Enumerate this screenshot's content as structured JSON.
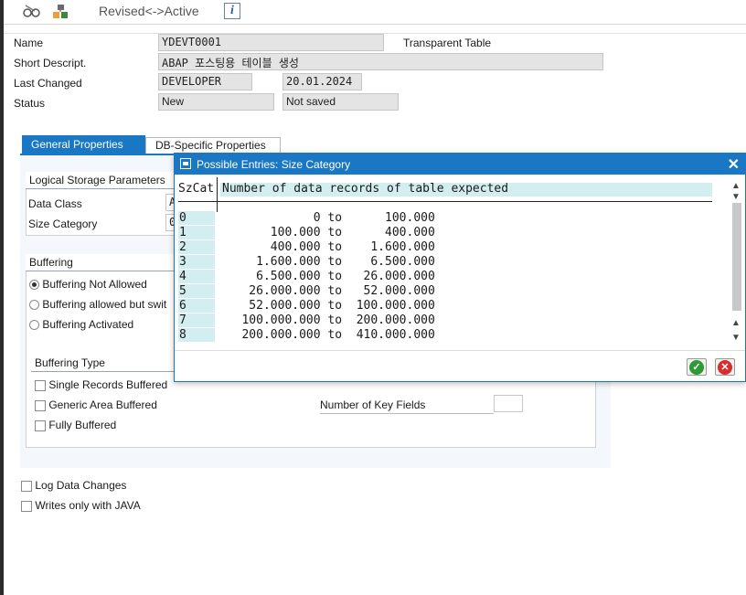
{
  "toolbar": {
    "glasses_icon": "glasses-icon",
    "hierarchy_icon": "hierarchy-icon",
    "toggle_label": "Revised<->Active",
    "info_icon_glyph": "i"
  },
  "header": {
    "name_label": "Name",
    "name_value": "YDEVT0001",
    "object_type": "Transparent Table",
    "short_desc_label": "Short Descript.",
    "short_desc_value": "ABAP 포스팅용 테이블 생성",
    "last_changed_label": "Last Changed",
    "last_changed_user": "DEVELOPER",
    "last_changed_date": "20.01.2024",
    "status_label": "Status",
    "status_value": "New",
    "save_status": "Not saved"
  },
  "tabs": [
    {
      "label": "General Properties",
      "active": true
    },
    {
      "label": "DB-Specific Properties",
      "active": false
    }
  ],
  "general": {
    "logical_storage_title": "Logical Storage Parameters",
    "data_class_label": "Data Class",
    "data_class_value": "A",
    "size_category_label": "Size Category",
    "size_category_value": "0",
    "buffering_title": "Buffering",
    "buffering_options": [
      {
        "label": "Buffering Not Allowed",
        "selected": true
      },
      {
        "label": "Buffering allowed but swit",
        "selected": false
      },
      {
        "label": "Buffering Activated",
        "selected": false
      }
    ],
    "buffering_type_title": "Buffering Type",
    "buffering_types": [
      {
        "label": "Single Records Buffered",
        "checked": false
      },
      {
        "label": "Generic Area Buffered",
        "checked": false
      },
      {
        "label": "Fully Buffered",
        "checked": false
      }
    ],
    "key_fields_label": "Number of Key Fields",
    "key_fields_value": "",
    "log_data_changes": "Log Data Changes",
    "writes_only_java": "Writes only with JAVA"
  },
  "dialog": {
    "title": "Possible Entries: Size Category",
    "col_cat": "SzCat",
    "col_desc": "Number of data records of table expected",
    "rows": [
      {
        "cat": "0",
        "from": "0",
        "to": "100.000"
      },
      {
        "cat": "1",
        "from": "100.000",
        "to": "400.000"
      },
      {
        "cat": "2",
        "from": "400.000",
        "to": "1.600.000"
      },
      {
        "cat": "3",
        "from": "1.600.000",
        "to": "6.500.000"
      },
      {
        "cat": "4",
        "from": "6.500.000",
        "to": "26.000.000"
      },
      {
        "cat": "5",
        "from": "26.000.000",
        "to": "52.000.000"
      },
      {
        "cat": "6",
        "from": "52.000.000",
        "to": "100.000.000"
      },
      {
        "cat": "7",
        "from": "100.000.000",
        "to": "200.000.000"
      },
      {
        "cat": "8",
        "from": "200.000.000",
        "to": "410.000.000"
      }
    ],
    "range_word": "to",
    "close_glyph": "✕",
    "ok_glyph": "✓",
    "cancel_glyph": "✕"
  }
}
